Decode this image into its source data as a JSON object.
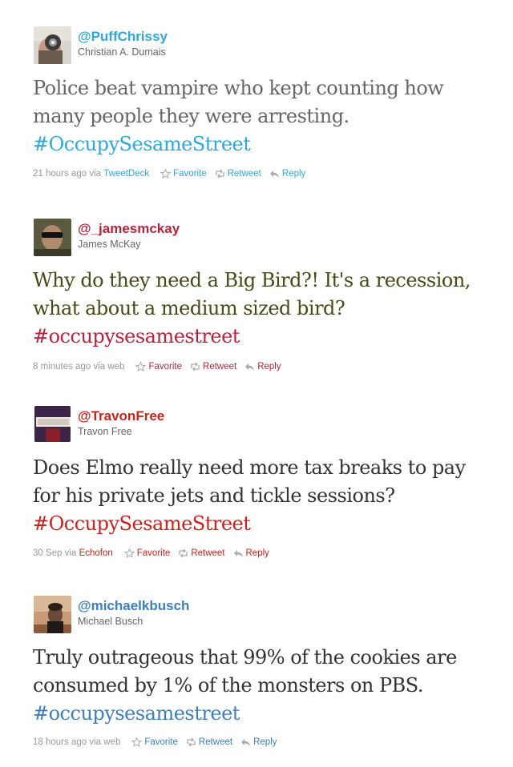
{
  "tweets": [
    {
      "handle": "@PuffChrissy",
      "name": "Christian A. Dumais",
      "text": "Police beat vampire who kept counting how many people they were arresting.",
      "hashtag": "#OccupySesameStreet",
      "time": "21 hours ago",
      "via": "via",
      "source": "TweetDeck",
      "favorite": "Favorite",
      "retweet": "Retweet",
      "reply": "Reply",
      "colors": {
        "link": "#2fa8dc",
        "text": "#666666"
      }
    },
    {
      "handle": "@_jamesmckay",
      "name": "James McKay",
      "text": "Why do they need a Big Bird?! It's a recession, what about a medium sized bird?",
      "hashtag": "#occupysesamestreet",
      "time": "8 minutes ago",
      "via": "via",
      "source": "web",
      "favorite": "Favorite",
      "retweet": "Retweet",
      "reply": "Reply",
      "colors": {
        "link": "#b8243e",
        "text": "#4a4a17"
      }
    },
    {
      "handle": "@TravonFree",
      "name": "Travon Free",
      "text": "Does Elmo really need more tax breaks to pay for his private jets and tickle sessions?",
      "hashtag": "#OccupySesameStreet",
      "time": "30 Sep",
      "via": "via",
      "source": "Echofon",
      "favorite": "Favorite",
      "retweet": "Retweet",
      "reply": "Reply",
      "colors": {
        "link": "#c8241c",
        "text": "#333333"
      }
    },
    {
      "handle": "@michaelkbusch",
      "name": "Michael Busch",
      "text": "Truly outrageous that 99% of the cookies are consumed by 1% of the monsters on PBS.",
      "hashtag": "#occupysesamestreet",
      "time": "18 hours ago",
      "via": "via",
      "source": "web",
      "favorite": "Favorite",
      "retweet": "Retweet",
      "reply": "Reply",
      "colors": {
        "link": "#3b7fbf",
        "text": "#333333"
      }
    }
  ]
}
